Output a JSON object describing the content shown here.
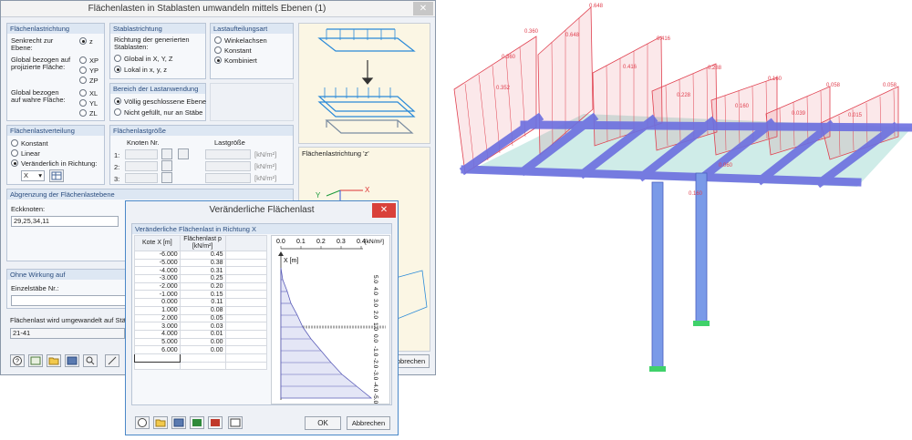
{
  "main_window": {
    "title": "Flächenlasten in Stablasten umwandeln mittels Ebenen   (1)",
    "close": "✕",
    "flaechenlastrichtung": {
      "header": "Flächenlastrichtung",
      "senkrecht_label": "Senkrecht zur Ebene:",
      "global_proj_label": "Global bezogen auf projizierte Fläche:",
      "global_wahre_label": "Global bezogen auf wahre Fläche:",
      "options": [
        "z",
        "XP",
        "YP",
        "ZP",
        "XL",
        "YL",
        "ZL"
      ],
      "selected": "z"
    },
    "stablastrichtung": {
      "header": "Stablastrichtung",
      "desc": "Richtung der generierten Stablasten:",
      "options": [
        "Global in X, Y, Z",
        "Lokal in x, y, z"
      ],
      "selected": "Lokal in x, y, z"
    },
    "lastaufteilungsart": {
      "header": "Lastaufteilungsart",
      "options": [
        "Winkelachsen",
        "Konstant",
        "Kombiniert"
      ],
      "selected": "Kombiniert"
    },
    "bereich": {
      "header": "Bereich der Lastanwendung",
      "options": [
        "Völlig geschlossene Ebene",
        "Nicht gefüllt, nur an Stäbe"
      ],
      "selected": "Völlig geschlossene Ebene"
    },
    "flaechenlastverteilung": {
      "header": "Flächenlastverteilung",
      "options": [
        "Konstant",
        "Linear",
        "Veränderlich in Richtung:"
      ],
      "selected": "Veränderlich in Richtung:",
      "direction": "X"
    },
    "flaechenlastgroesse": {
      "header": "Flächenlastgröße",
      "knoten_header": "Knoten Nr.",
      "lastgroesse_header": "Lastgröße",
      "rows": [
        "1:",
        "2:",
        "3:"
      ],
      "unit": "[kN/m²]"
    },
    "preview_caption": "Flächenlastrichtung 'z'",
    "abgrenzung": {
      "header": "Abgrenzung der Flächenlastebene",
      "eckknoten_label": "Eckknoten:",
      "eckknoten_value": "29,25,34,11"
    },
    "ohne_wirkung": {
      "header": "Ohne Wirkung auf",
      "einzelstaebe_label": "Einzelstäbe Nr.:",
      "einzelstaebe_value": ""
    },
    "umgewandelt": {
      "label": "Flächenlast wird umgewandelt auf Stäbe",
      "value": "21-41"
    },
    "abbrechen": "Abbrechen"
  },
  "dialog": {
    "title": "Veränderliche Flächenlast",
    "close": "✕",
    "group_header": "Veränderliche Flächenlast in Richtung X",
    "col1_header": "Kote X [m]",
    "col2_header": "Flächenlast p [kN/m²]",
    "rows": [
      {
        "x": "-6.000",
        "p": "0.45"
      },
      {
        "x": "-5.000",
        "p": "0.38"
      },
      {
        "x": "-4.000",
        "p": "0.31"
      },
      {
        "x": "-3.000",
        "p": "0.25"
      },
      {
        "x": "-2.000",
        "p": "0.20"
      },
      {
        "x": "-1.000",
        "p": "0.15"
      },
      {
        "x": "0.000",
        "p": "0.11"
      },
      {
        "x": "1.000",
        "p": "0.08"
      },
      {
        "x": "2.000",
        "p": "0.05"
      },
      {
        "x": "3.000",
        "p": "0.03"
      },
      {
        "x": "4.000",
        "p": "0.01"
      },
      {
        "x": "5.000",
        "p": "0.00"
      },
      {
        "x": "6.000",
        "p": "0.00"
      }
    ],
    "chart_x_ticks": [
      "0.0",
      "0.1",
      "0.2",
      "0.3",
      "0.4"
    ],
    "chart_unit": "[kN/m²]",
    "chart_axis_label": "X [m]",
    "chart_y_ticks": [
      "5.0",
      "4.0",
      "3.0",
      "2.0",
      "1.0",
      "0.0",
      "-1.0",
      "-2.0",
      "-3.0",
      "-4.0",
      "-5.0"
    ],
    "ok": "OK",
    "abbrechen": "Abbrechen"
  },
  "model_view": {
    "load_labels": [
      "0.648",
      "0.360",
      "0.648",
      "0.360",
      "0.352",
      "0.416",
      "0.416",
      "0.288",
      "0.228",
      "0.160",
      "0.160",
      "0.058",
      "0.039",
      "0.058",
      "0.015",
      "0.060",
      "0.160"
    ],
    "colors": {
      "load": "#e0404f",
      "beam": "#6c6fe0",
      "plate": "#a8dcd6",
      "column": "#7a9ae8",
      "support": "#3fd16a"
    }
  }
}
